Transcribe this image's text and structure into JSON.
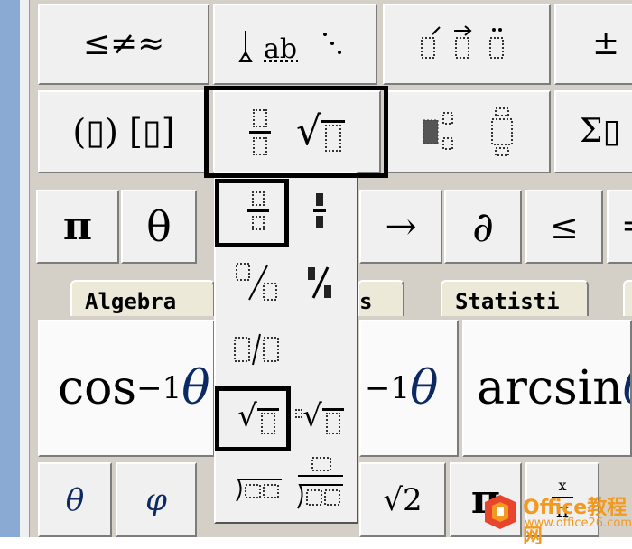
{
  "toolbar": {
    "row1": [
      "≤≠≈",
      "",
      "",
      "±"
    ],
    "row2": [
      "(▯) [▯]",
      "",
      "",
      "Σ▯"
    ],
    "symbols": [
      "π",
      "θ",
      "→",
      "∂",
      "≤",
      "="
    ]
  },
  "tabs": [
    "Algebra",
    "s",
    "Statisti"
  ],
  "templates": {
    "cos_inverse": {
      "fn": "cos",
      "exp": "−1",
      "var": "θ"
    },
    "mid_inverse": {
      "exp": "−1",
      "var": "θ"
    },
    "arcsin": {
      "fn": "arcsin",
      "var": "θ"
    }
  },
  "small_buttons": [
    "θ",
    "φ",
    "√2",
    "π"
  ],
  "fraction_dropdown": {
    "items": [
      "full-size fraction",
      "small fraction",
      "full-size slash fraction",
      "small slash fraction",
      "slash fraction",
      "square root",
      "nth root",
      "long division",
      "long division with quotient"
    ]
  },
  "watermark": {
    "name": "Office教程网",
    "url": "www.office26.com",
    "colors": {
      "orange": "#f29a1f",
      "red": "#e8452c"
    }
  }
}
